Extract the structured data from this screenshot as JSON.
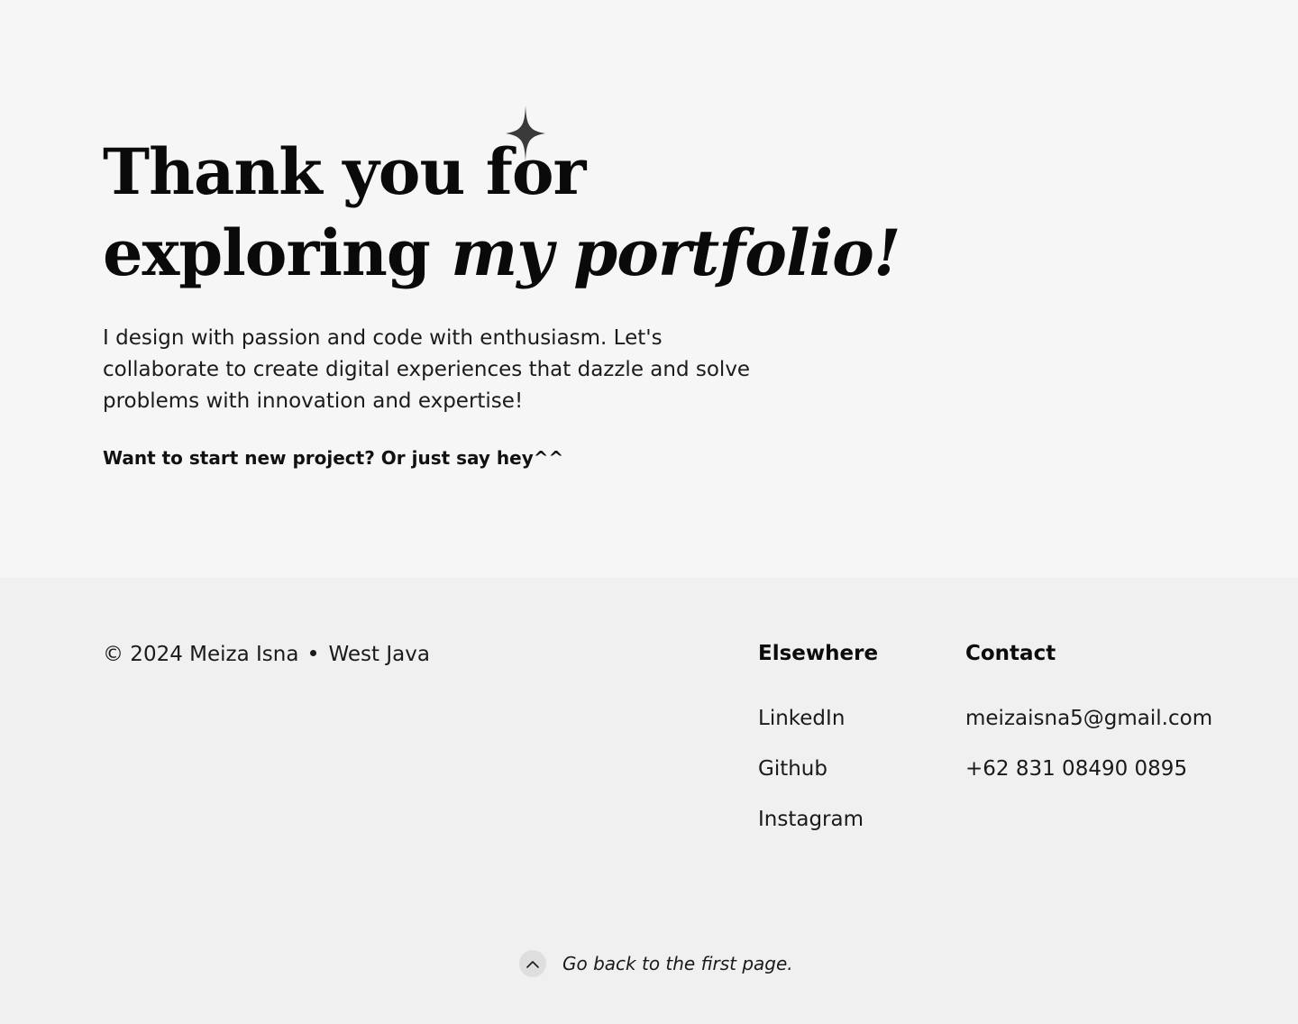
{
  "hero": {
    "headline_line1": "Thank you for",
    "headline_line2_plain": "exploring ",
    "headline_line2_italic": "my portfolio!",
    "intro": "I design with passion and code with enthusiasm. Let's collaborate to create digital experiences that dazzle and solve problems with innovation and expertise!",
    "cta": "Want to start new project? Or just say hey^^",
    "sparkle_icon": "four-point-star-icon",
    "sparkle_color": "#3a3a3a"
  },
  "footer": {
    "copyright": "© 2024 Meiza Isna",
    "location": "West Java",
    "elsewhere": {
      "title": "Elsewhere",
      "links": [
        "LinkedIn",
        "Github",
        "Instagram"
      ]
    },
    "contact": {
      "title": "Contact",
      "email": "meizaisna5@gmail.com",
      "phone": "+62 831 08490 0895"
    },
    "back_to_top": {
      "label": "Go back to the first page.",
      "icon": "chevron-up-icon"
    }
  },
  "colors": {
    "hero_background": "#f6f6f6",
    "footer_background": "#f0f0f0",
    "text": "#111111"
  }
}
